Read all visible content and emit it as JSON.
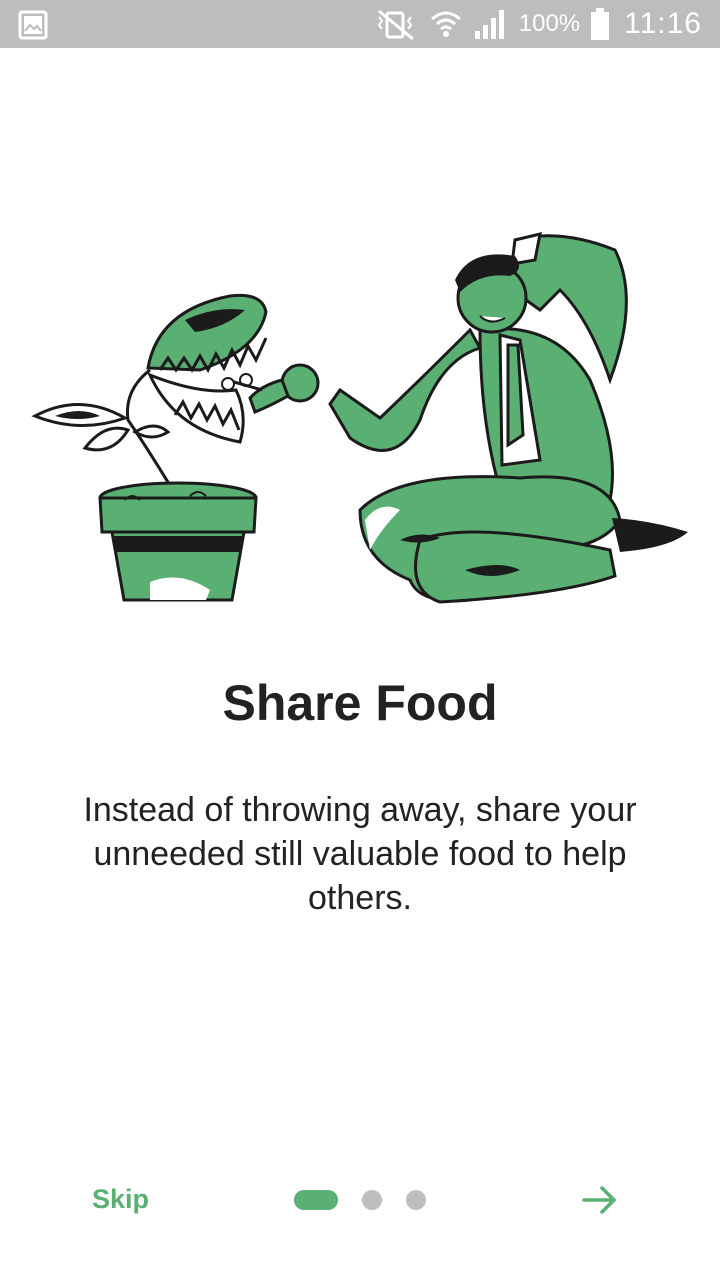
{
  "status_bar": {
    "battery": "100%",
    "time": "11:16",
    "icons": [
      "image-notification-icon",
      "vibrate-silent-icon",
      "wifi-icon",
      "cellular-signal-icon",
      "battery-icon"
    ]
  },
  "onboarding": {
    "title": "Share Food",
    "description": "Instead of throwing away, share your unneeded still valuable food to help others.",
    "skip_label": "Skip",
    "page_index": 1,
    "page_count": 3
  },
  "colors": {
    "accent": "#5aaf73",
    "status_bar": "#bdbdbd",
    "inactive_dot": "#bdbdbd",
    "text": "#222222"
  }
}
